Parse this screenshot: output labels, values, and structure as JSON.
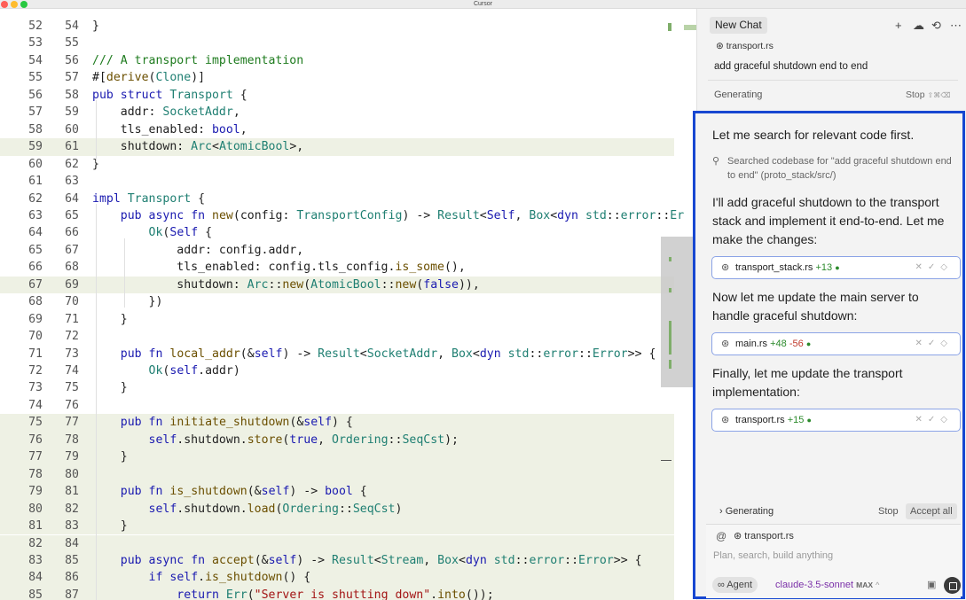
{
  "window": {
    "title": "Cursor"
  },
  "editor": {
    "lines": [
      {
        "a": "52",
        "b": "54",
        "code": "}",
        "hl": false
      },
      {
        "a": "53",
        "b": "55",
        "code": "",
        "hl": false
      },
      {
        "a": "54",
        "b": "56",
        "code": "/// A transport implementation",
        "hl": false
      },
      {
        "a": "55",
        "b": "57",
        "code": "#[derive(Clone)]",
        "hl": false
      },
      {
        "a": "56",
        "b": "58",
        "code": "pub struct Transport {",
        "hl": false
      },
      {
        "a": "57",
        "b": "59",
        "code": "    addr: SocketAddr,",
        "hl": false
      },
      {
        "a": "58",
        "b": "60",
        "code": "    tls_enabled: bool,",
        "hl": false
      },
      {
        "a": "59",
        "b": "61",
        "code": "    shutdown: Arc<AtomicBool>,",
        "hl": true
      },
      {
        "a": "60",
        "b": "62",
        "code": "}",
        "hl": false
      },
      {
        "a": "61",
        "b": "63",
        "code": "",
        "hl": false
      },
      {
        "a": "62",
        "b": "64",
        "code": "impl Transport {",
        "hl": false
      },
      {
        "a": "63",
        "b": "65",
        "code": "    pub async fn new(config: TransportConfig) -> Result<Self, Box<dyn std::error::Er",
        "hl": false
      },
      {
        "a": "64",
        "b": "66",
        "code": "        Ok(Self {",
        "hl": false
      },
      {
        "a": "65",
        "b": "67",
        "code": "            addr: config.addr,",
        "hl": false
      },
      {
        "a": "66",
        "b": "68",
        "code": "            tls_enabled: config.tls_config.is_some(),",
        "hl": false
      },
      {
        "a": "67",
        "b": "69",
        "code": "            shutdown: Arc::new(AtomicBool::new(false)),",
        "hl": true
      },
      {
        "a": "68",
        "b": "70",
        "code": "        })",
        "hl": false
      },
      {
        "a": "69",
        "b": "71",
        "code": "    }",
        "hl": false
      },
      {
        "a": "70",
        "b": "72",
        "code": "",
        "hl": false
      },
      {
        "a": "71",
        "b": "73",
        "code": "    pub fn local_addr(&self) -> Result<SocketAddr, Box<dyn std::error::Error>> {",
        "hl": false
      },
      {
        "a": "72",
        "b": "74",
        "code": "        Ok(self.addr)",
        "hl": false
      },
      {
        "a": "73",
        "b": "75",
        "code": "    }",
        "hl": false
      },
      {
        "a": "74",
        "b": "76",
        "code": "",
        "hl": false
      },
      {
        "a": "75",
        "b": "77",
        "code": "    pub fn initiate_shutdown(&self) {",
        "hl": true
      },
      {
        "a": "76",
        "b": "78",
        "code": "        self.shutdown.store(true, Ordering::SeqCst);",
        "hl": true
      },
      {
        "a": "77",
        "b": "79",
        "code": "    }",
        "hl": true
      },
      {
        "a": "78",
        "b": "80",
        "code": "",
        "hl": true
      },
      {
        "a": "79",
        "b": "81",
        "code": "    pub fn is_shutdown(&self) -> bool {",
        "hl": true
      },
      {
        "a": "80",
        "b": "82",
        "code": "        self.shutdown.load(Ordering::SeqCst)",
        "hl": true
      },
      {
        "a": "81",
        "b": "83",
        "code": "    }",
        "hl": true
      },
      {
        "a": "82",
        "b": "84",
        "code": "",
        "hl": true
      },
      {
        "a": "83",
        "b": "85",
        "code": "    pub async fn accept(&self) -> Result<Stream, Box<dyn std::error::Error>> {",
        "hl": true
      },
      {
        "a": "84",
        "b": "86",
        "code": "        if self.is_shutdown() {",
        "hl": true
      },
      {
        "a": "85",
        "b": "87",
        "code": "            return Err(\"Server is shutting down\".into());",
        "hl": true
      }
    ]
  },
  "chat": {
    "tab_label": "New Chat",
    "icons": [
      "plus-icon",
      "cloud-icon",
      "history-icon",
      "more-icon"
    ],
    "context_file": "transport.rs",
    "user_message": "add graceful shutdown end to end",
    "generating_label": "Generating",
    "stop_label": "Stop",
    "stop_shortcut": "⇧⌘⌫",
    "messages": {
      "m1": "Let me search for relevant code first.",
      "search_note": "Searched codebase for \"add graceful shutdown end to end\" (proto_stack/src/)",
      "m2": "I'll add graceful shutdown to the transport stack and implement it end-to-end. Let me make the changes:",
      "m3": "Now let me update the main server to handle graceful shutdown:",
      "m4": "Finally, let me update the transport implementation:"
    },
    "files": [
      {
        "name": "transport_stack.rs",
        "added": "+13",
        "removed": ""
      },
      {
        "name": "main.rs",
        "added": "+48",
        "removed": "-56"
      },
      {
        "name": "transport.rs",
        "added": "+15",
        "removed": ""
      }
    ],
    "footer": {
      "generating_label": "Generating",
      "stop_label": "Stop",
      "accept_all_label": "Accept all"
    },
    "composer": {
      "at_symbol": "@",
      "context_chip": "transport.rs",
      "placeholder": "Plan, search, build anything",
      "mode_label": "Agent",
      "model_label": "claude-3.5-sonnet",
      "model_badge": "MAX"
    }
  },
  "colors": {
    "accent_box": "#1747d1",
    "added": "#2b8a2b",
    "removed": "#c0392b",
    "highlight": "#eef1e4"
  }
}
